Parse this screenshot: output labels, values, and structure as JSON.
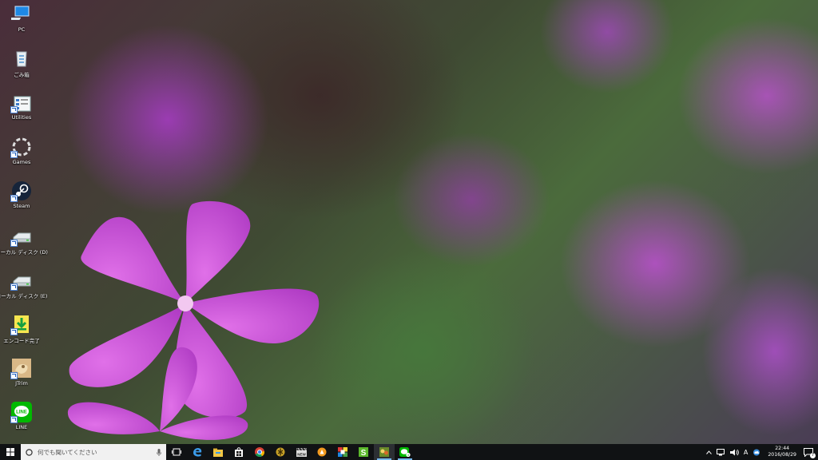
{
  "desktop": {
    "icons": [
      {
        "label": "PC",
        "icon": "computer-icon"
      },
      {
        "label": "ごみ箱",
        "icon": "recycle-bin-icon"
      },
      {
        "label": "Utilities",
        "icon": "utilities-folder-icon"
      },
      {
        "label": "Games",
        "icon": "games-icon"
      },
      {
        "label": "Steam",
        "icon": "steam-icon"
      },
      {
        "label": "ローカル ディスク (D)",
        "icon": "drive-icon"
      },
      {
        "label": "ローカル ディスク (E)",
        "icon": "drive-icon"
      },
      {
        "label": "エンコード完了",
        "icon": "download-icon"
      },
      {
        "label": "JTrim",
        "icon": "jtrim-icon"
      },
      {
        "label": "LINE",
        "icon": "line-icon"
      }
    ]
  },
  "taskbar": {
    "search_placeholder": "何でも聞いてください",
    "apps": [
      "task-view-icon",
      "edge-icon",
      "file-explorer-icon",
      "store-icon",
      "chrome-icon",
      "app-gold-icon",
      "video-editor-icon",
      "app-orange-icon",
      "app-grid-icon",
      "app-s-icon",
      "app-game-icon",
      "line-icon"
    ],
    "line_badge": "4",
    "tray": {
      "ime": "A",
      "time": "22:44",
      "date": "2016/08/29",
      "notification_count": "7"
    }
  },
  "colors": {
    "taskbar": "#101214",
    "accent": "#76b9ed",
    "line_green": "#00b900"
  }
}
